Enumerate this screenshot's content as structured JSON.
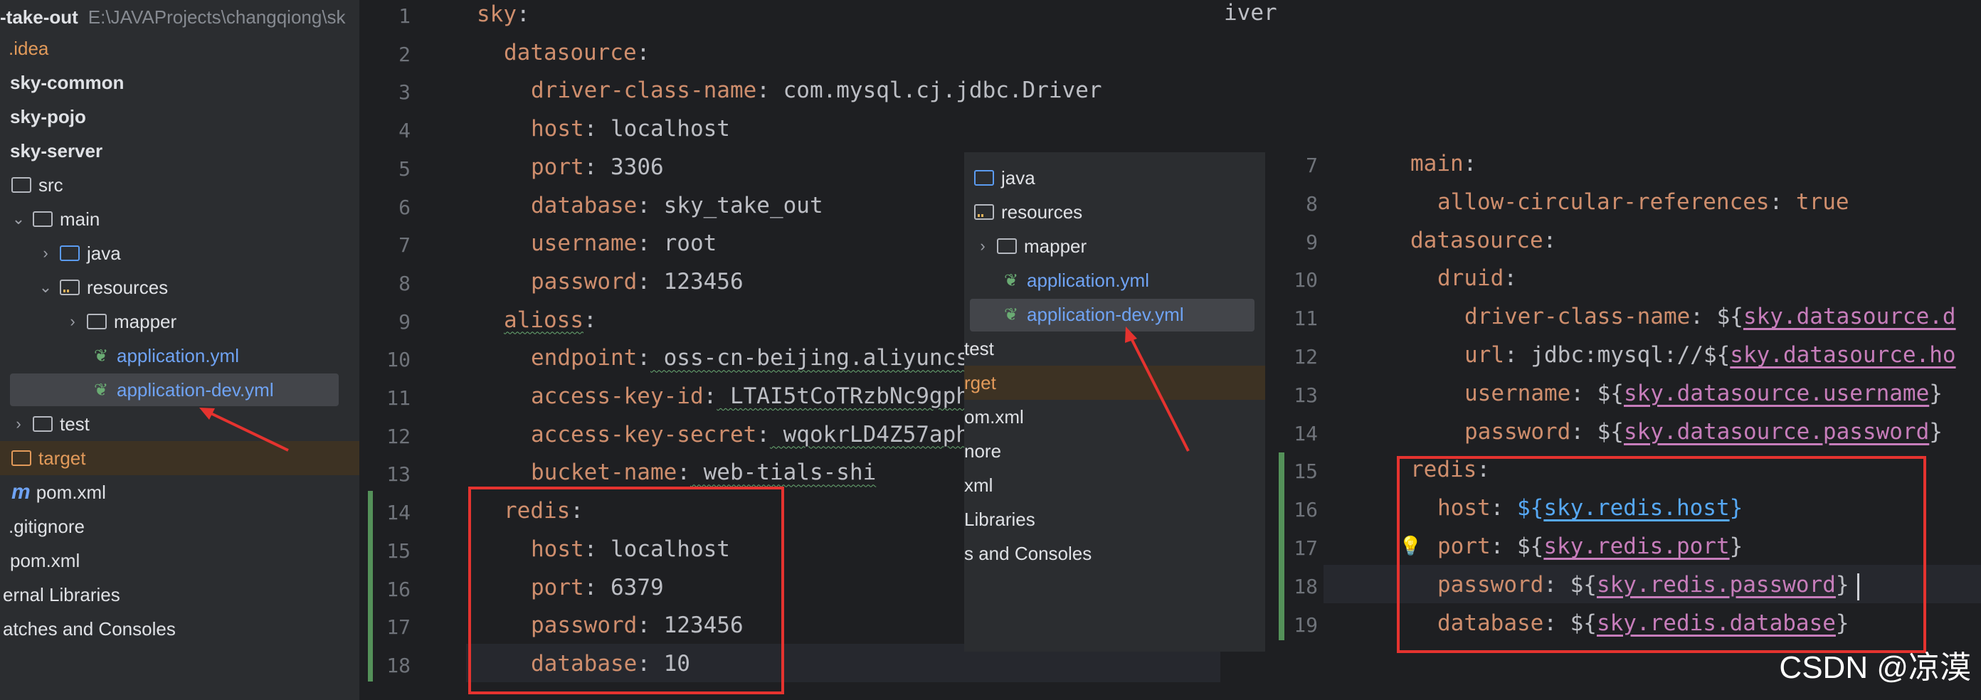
{
  "project_tree": {
    "header_name": "-take-out",
    "header_path": "E:\\JAVAProjects\\changqiong\\sk",
    "items": [
      {
        "label": ".idea"
      },
      {
        "label": "sky-common"
      },
      {
        "label": "sky-pojo"
      },
      {
        "label": "sky-server"
      },
      {
        "label": "src"
      },
      {
        "label": "main"
      },
      {
        "label": "java"
      },
      {
        "label": "resources"
      },
      {
        "label": "mapper"
      },
      {
        "label": "application.yml"
      },
      {
        "label": "application-dev.yml"
      },
      {
        "label": "test"
      },
      {
        "label": "target"
      },
      {
        "label": "pom.xml"
      },
      {
        "label": ".gitignore"
      },
      {
        "label": "pom.xml"
      },
      {
        "label": "ernal Libraries"
      },
      {
        "label": "atches and Consoles"
      }
    ]
  },
  "editor_left": {
    "lines": [
      {
        "n": "1",
        "k": "sky",
        "sep": ":",
        "v": ""
      },
      {
        "n": "2",
        "k": "datasource",
        "sep": ":",
        "v": ""
      },
      {
        "n": "3",
        "k": "driver-class-name",
        "sep": ":",
        "v": " com.mysql.cj.jdbc.Driver"
      },
      {
        "n": "4",
        "k": "host",
        "sep": ":",
        "v": " localhost"
      },
      {
        "n": "5",
        "k": "port",
        "sep": ":",
        "v": " 3306"
      },
      {
        "n": "6",
        "k": "database",
        "sep": ":",
        "v": " sky_take_out"
      },
      {
        "n": "7",
        "k": "username",
        "sep": ":",
        "v": " root"
      },
      {
        "n": "8",
        "k": "password",
        "sep": ":",
        "v": " 123456"
      },
      {
        "n": "9",
        "k": "alioss",
        "sep": ":",
        "v": ""
      },
      {
        "n": "10",
        "k": "endpoint",
        "sep": ":",
        "v": " oss-cn-beijing.aliyuncs"
      },
      {
        "n": "11",
        "k": "access-key-id",
        "sep": ":",
        "v": " LTAI5tCoTRzbNc9gph"
      },
      {
        "n": "12",
        "k": "access-key-secret",
        "sep": ":",
        "v": " wqokrLD4Z57aph"
      },
      {
        "n": "13",
        "k": "bucket-name",
        "sep": ":",
        "v": " web-tials-shi"
      },
      {
        "n": "14",
        "k": "redis",
        "sep": ":",
        "v": ""
      },
      {
        "n": "15",
        "k": "host",
        "sep": ":",
        "v": " localhost"
      },
      {
        "n": "16",
        "k": "port",
        "sep": ":",
        "v": " 6379"
      },
      {
        "n": "17",
        "k": "password",
        "sep": ":",
        "v": " 123456"
      },
      {
        "n": "18",
        "k": "database",
        "sep": ":",
        "v": " 10"
      }
    ],
    "top_right_fragment": "iver"
  },
  "overlay_tree": {
    "items": [
      {
        "label": "java"
      },
      {
        "label": "resources"
      },
      {
        "label": "mapper"
      },
      {
        "label": "application.yml"
      },
      {
        "label": "application-dev.yml"
      },
      {
        "label": "test"
      },
      {
        "label": "rget"
      },
      {
        "label": "om.xml"
      },
      {
        "label": "nore"
      },
      {
        "label": "xml"
      },
      {
        "label": "Libraries"
      },
      {
        "label": "s and Consoles"
      }
    ]
  },
  "editor_right": {
    "lines": [
      {
        "n": "7",
        "k": "main",
        "sep": ":",
        "pre": "",
        "ref": "",
        "post": ""
      },
      {
        "n": "8",
        "k": "allow-circular-references",
        "sep": ": ",
        "pre": "true",
        "ref": "",
        "post": ""
      },
      {
        "n": "9",
        "k": "datasource",
        "sep": ":",
        "pre": "",
        "ref": "",
        "post": ""
      },
      {
        "n": "10",
        "k": "druid",
        "sep": ":",
        "pre": "",
        "ref": "",
        "post": ""
      },
      {
        "n": "11",
        "k": "driver-class-name",
        "sep": ": ",
        "pre": "${",
        "ref": "sky.datasource.d",
        "post": ""
      },
      {
        "n": "12",
        "k": "url",
        "sep": ": ",
        "pre": "jdbc:mysql://${",
        "ref": "sky.datasource.ho",
        "post": ""
      },
      {
        "n": "13",
        "k": "username",
        "sep": ": ",
        "pre": "${",
        "ref": "sky.datasource.username",
        "post": "}"
      },
      {
        "n": "14",
        "k": "password",
        "sep": ": ",
        "pre": "${",
        "ref": "sky.datasource.password",
        "post": "}"
      },
      {
        "n": "15",
        "k": "redis",
        "sep": ":",
        "pre": "",
        "ref": "",
        "post": ""
      },
      {
        "n": "16",
        "k": "host",
        "sep": ": ",
        "pre": "${",
        "ref": "sky.redis.host",
        "post": "}"
      },
      {
        "n": "17",
        "k": "port",
        "sep": ": ",
        "pre": "${",
        "ref": "sky.redis.port",
        "post": "}"
      },
      {
        "n": "18",
        "k": "password",
        "sep": ": ",
        "pre": "${",
        "ref": "sky.redis.password",
        "post": "}"
      },
      {
        "n": "19",
        "k": "database",
        "sep": ": ",
        "pre": "${",
        "ref": "sky.redis.database",
        "post": "}"
      }
    ]
  },
  "watermark": "CSDN @凉漠",
  "colors": {
    "annotation": "#e5332f",
    "key": "#cf8e6d",
    "selection": "#43454a"
  }
}
